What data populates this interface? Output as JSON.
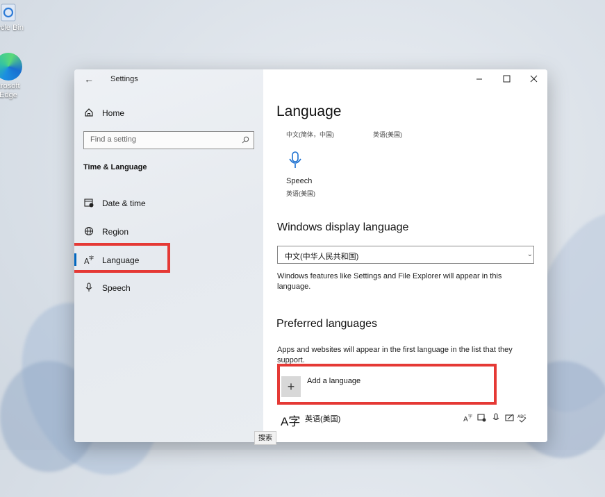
{
  "desktop": {
    "icons": [
      {
        "label": "Recycle Bin",
        "icon": "recycle-bin-icon"
      },
      {
        "label": "Microsoft Edge",
        "icon": "edge-icon"
      }
    ],
    "recycle_label": "cycle Bin",
    "edge_label_1": "crosoft",
    "edge_label_2": "Edge"
  },
  "window": {
    "title": "Settings",
    "controls": {
      "minimize": "—",
      "maximize": "☐",
      "close": "✕"
    }
  },
  "sidebar": {
    "home": "Home",
    "search_placeholder": "Find a setting",
    "section": "Time & Language",
    "items": [
      {
        "label": "Date & time",
        "icon": "calendar-clock-icon"
      },
      {
        "label": "Region",
        "icon": "globe-icon"
      },
      {
        "label": "Language",
        "icon": "language-icon",
        "selected": true
      },
      {
        "label": "Speech",
        "icon": "microphone-icon"
      }
    ]
  },
  "main": {
    "title": "Language",
    "top_langs": [
      "中文(简体，中国)",
      "英语(美国)"
    ],
    "speech": {
      "label": "Speech",
      "sub": "英语(美国)"
    },
    "display_lang": {
      "heading": "Windows display language",
      "selected": "中文(中华人民共和国)",
      "desc": "Windows features like Settings and File Explorer will appear in this language."
    },
    "preferred": {
      "heading": "Preferred languages",
      "desc": "Apps and websites will appear in the first language in the list that they support.",
      "add_label": "Add a language",
      "languages": [
        {
          "name": "英语(美国)",
          "glyph": "A字"
        }
      ]
    }
  },
  "tooltip": "搜索",
  "colors": {
    "accent": "#0067c0",
    "highlight": "#e53935"
  }
}
